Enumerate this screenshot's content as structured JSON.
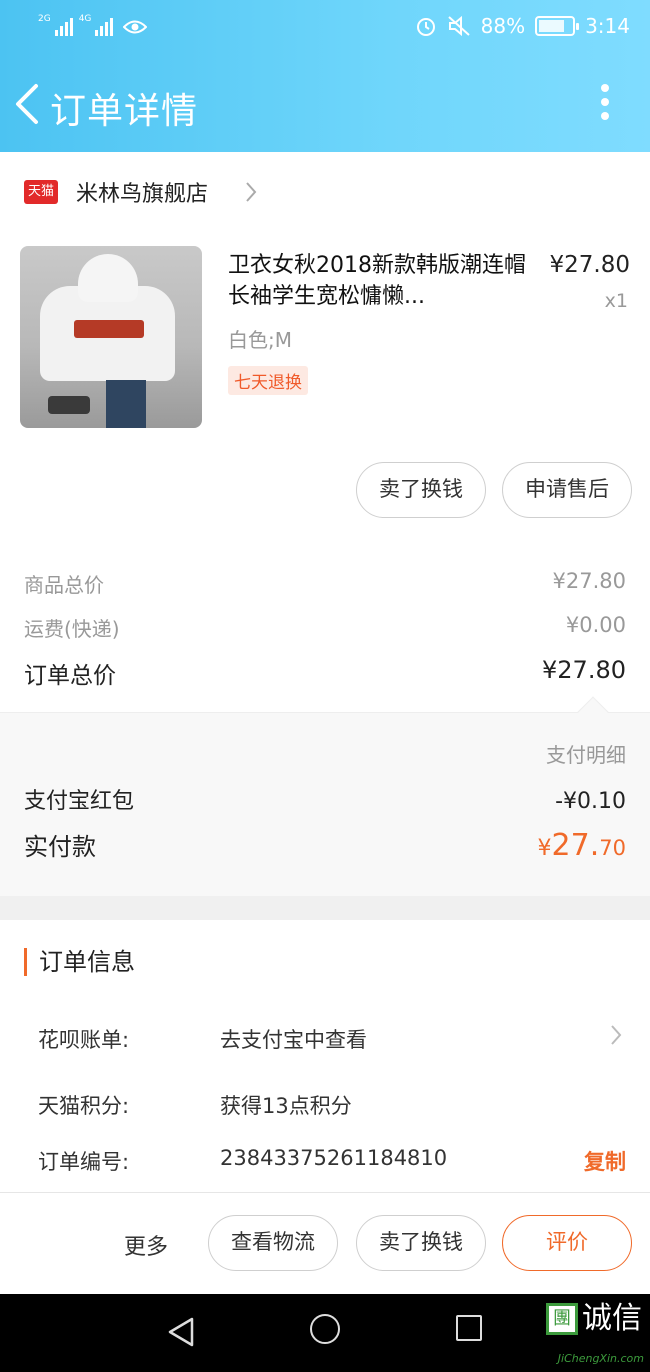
{
  "status_bar": {
    "signal_1_label": "2G",
    "signal_2_label": "4G",
    "battery_percent": "88%",
    "time": "3:14"
  },
  "nav": {
    "title": "订单详情"
  },
  "store": {
    "platform_badge": "天猫",
    "name": "米林鸟旗舰店"
  },
  "product": {
    "title": "卫衣女秋2018新款韩版潮连帽长袖学生宽松慵懒...",
    "price": "¥27.80",
    "quantity": "x1",
    "sku": "白色;M",
    "badge": "七天退换",
    "actions": [
      "卖了换钱",
      "申请售后"
    ]
  },
  "summary": {
    "goods_total_label": "商品总价",
    "goods_total_value": "¥27.80",
    "shipping_label": "运费(快递)",
    "shipping_value": "¥0.00",
    "order_total_label": "订单总价",
    "order_total_value": "¥27.80"
  },
  "payment": {
    "detail_link": "支付明细",
    "redpacket_label": "支付宝红包",
    "redpacket_value": "-¥0.10",
    "actual_label": "实付款",
    "actual_currency": "¥",
    "actual_int": "27.",
    "actual_dec": "70"
  },
  "order_info": {
    "title": "订单信息",
    "rows": [
      {
        "label": "花呗账单:",
        "value": "去支付宝中查看"
      },
      {
        "label": "天猫积分:",
        "value": "获得13点积分"
      },
      {
        "label": "订单编号:",
        "value": "2384337526118481​0",
        "action": "复制"
      }
    ]
  },
  "bottom_bar": {
    "more": "更多",
    "buttons": [
      "查看物流",
      "卖了换钱",
      "评价"
    ]
  },
  "watermark": {
    "logo": "團",
    "text": "诚信",
    "sub": "JiChengXin.com"
  },
  "colors": {
    "header_gradient_start": "#4cc3f2",
    "header_gradient_end": "#7fdcff",
    "accent_orange": "#f06a2a"
  }
}
